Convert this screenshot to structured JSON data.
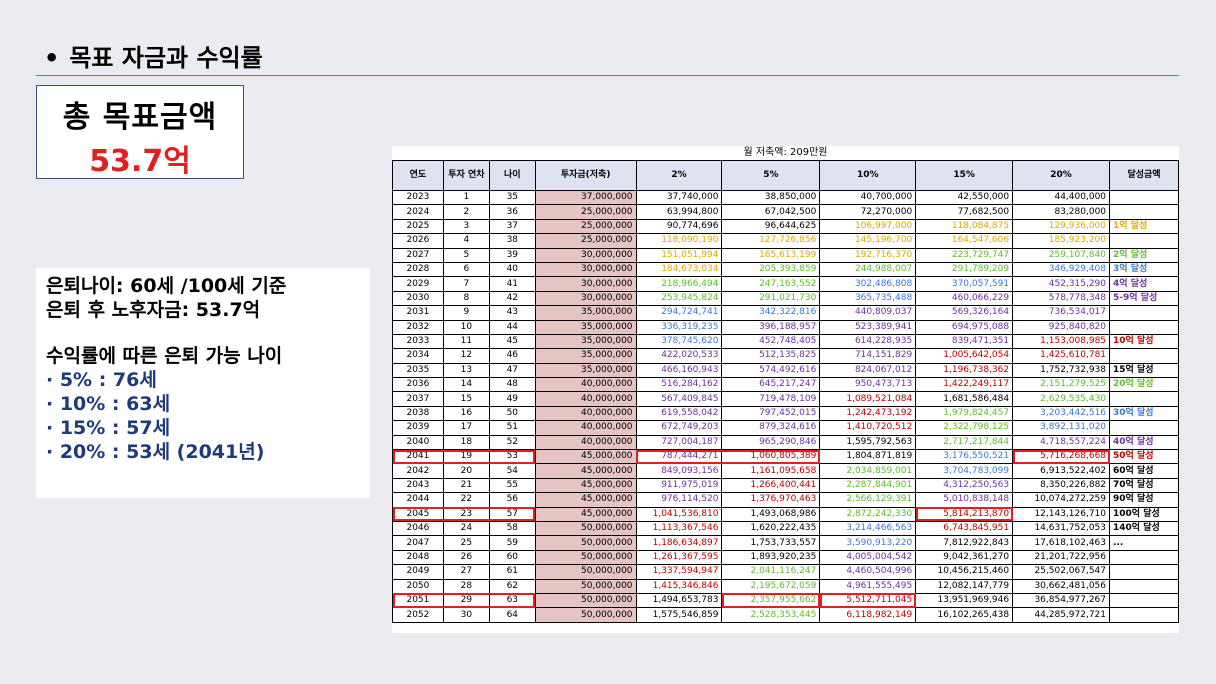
{
  "slide": {
    "bullet": "•",
    "title": "목표 자금과 수익률",
    "goal_label": "총 목표금액",
    "goal_value": "53.7억",
    "info": {
      "retire_age": "은퇴나이: 60세 /100세 기준",
      "retire_fund": "은퇴 후 노후자금: 53.7억",
      "rate_heading": "수익률에 따른 은퇴 가능 나이",
      "rates": [
        "· 5% : 76세",
        "· 10% : 63세",
        "· 15% : 57세",
        "· 20% : 53세 (2041년)"
      ]
    }
  },
  "sheet": {
    "caption": "월 저축액: 209만원",
    "headers": [
      "연도",
      "투자 연차",
      "나이",
      "투자금(저축)",
      "2%",
      "5%",
      "10%",
      "15%",
      "20%",
      "달성금액"
    ],
    "colors": {
      "gray": "#000000",
      "yellow": "#e0a800",
      "green": "#5cbf2a",
      "blue": "#3a78d8",
      "purple": "#7030a0",
      "red": "#c00000",
      "orange": "#e65c00"
    },
    "rows": [
      {
        "y": "2023",
        "n": "1",
        "a": "35",
        "inv": "37,000,000",
        "v": [
          "37,740,000",
          "38,850,000",
          "40,700,000",
          "42,550,000",
          "44,400,000"
        ],
        "c": [
          "k",
          "k",
          "k",
          "k",
          "k"
        ],
        "ach": "",
        "ac": "k"
      },
      {
        "y": "2024",
        "n": "2",
        "a": "36",
        "inv": "25,000,000",
        "v": [
          "63,994,800",
          "67,042,500",
          "72,270,000",
          "77,682,500",
          "83,280,000"
        ],
        "c": [
          "k",
          "k",
          "k",
          "k",
          "k"
        ],
        "ach": "",
        "ac": "k"
      },
      {
        "y": "2025",
        "n": "3",
        "a": "37",
        "inv": "25,000,000",
        "v": [
          "90,774,696",
          "96,644,625",
          "106,997,000",
          "118,084,875",
          "129,936,000"
        ],
        "c": [
          "k",
          "k",
          "y",
          "y",
          "y"
        ],
        "ach": "1억 달성",
        "ac": "y"
      },
      {
        "y": "2026",
        "n": "4",
        "a": "38",
        "inv": "25,000,000",
        "v": [
          "118,090,190",
          "127,726,856",
          "145,196,700",
          "164,547,606",
          "185,923,200"
        ],
        "c": [
          "y",
          "y",
          "y",
          "y",
          "y"
        ],
        "ach": "",
        "ac": "k"
      },
      {
        "y": "2027",
        "n": "5",
        "a": "39",
        "inv": "30,000,000",
        "v": [
          "151,051,994",
          "165,613,199",
          "192,716,370",
          "223,729,747",
          "259,107,840"
        ],
        "c": [
          "y",
          "y",
          "y",
          "g",
          "g"
        ],
        "ach": "2억 달성",
        "ac": "g"
      },
      {
        "y": "2028",
        "n": "6",
        "a": "40",
        "inv": "30,000,000",
        "v": [
          "184,673,034",
          "205,393,859",
          "244,988,007",
          "291,789,209",
          "346,929,408"
        ],
        "c": [
          "y",
          "g",
          "g",
          "g",
          "b"
        ],
        "ach": "3억 달성",
        "ac": "b"
      },
      {
        "y": "2029",
        "n": "7",
        "a": "41",
        "inv": "30,000,000",
        "v": [
          "218,966,494",
          "247,163,552",
          "302,486,808",
          "370,057,591",
          "452,315,290"
        ],
        "c": [
          "g",
          "g",
          "b",
          "b",
          "p"
        ],
        "ach": "4억 달성",
        "ac": "p"
      },
      {
        "y": "2030",
        "n": "8",
        "a": "42",
        "inv": "30,000,000",
        "v": [
          "253,945,824",
          "291,021,730",
          "365,735,488",
          "460,066,229",
          "578,778,348"
        ],
        "c": [
          "g",
          "g",
          "b",
          "p",
          "p"
        ],
        "ach": "5-9억 달성",
        "ac": "p"
      },
      {
        "y": "2031",
        "n": "9",
        "a": "43",
        "inv": "35,000,000",
        "v": [
          "294,724,741",
          "342,322,816",
          "440,809,037",
          "569,326,164",
          "736,534,017"
        ],
        "c": [
          "b",
          "b",
          "p",
          "p",
          "p"
        ],
        "ach": "",
        "ac": "k"
      },
      {
        "y": "2032",
        "n": "10",
        "a": "44",
        "inv": "35,000,000",
        "v": [
          "336,319,235",
          "396,188,957",
          "523,389,941",
          "694,975,088",
          "925,840,820"
        ],
        "c": [
          "b",
          "p",
          "p",
          "p",
          "p"
        ],
        "ach": "",
        "ac": "k"
      },
      {
        "y": "2033",
        "n": "11",
        "a": "45",
        "inv": "35,000,000",
        "v": [
          "378,745,620",
          "452,748,405",
          "614,228,935",
          "839,471,351",
          "1,153,008,985"
        ],
        "c": [
          "b",
          "p",
          "p",
          "p",
          "r"
        ],
        "ach": "10억 달성",
        "ac": "r"
      },
      {
        "y": "2034",
        "n": "12",
        "a": "46",
        "inv": "35,000,000",
        "v": [
          "422,020,533",
          "512,135,825",
          "714,151,829",
          "1,005,642,054",
          "1,425,610,781"
        ],
        "c": [
          "p",
          "p",
          "p",
          "r",
          "r"
        ],
        "ach": "",
        "ac": "k"
      },
      {
        "y": "2035",
        "n": "13",
        "a": "47",
        "inv": "35,000,000",
        "v": [
          "466,160,943",
          "574,492,616",
          "824,067,012",
          "1,196,738,362",
          "1,752,732,938"
        ],
        "c": [
          "p",
          "p",
          "p",
          "r",
          "k"
        ],
        "ach": "15억 달성",
        "ac": "k"
      },
      {
        "y": "2036",
        "n": "14",
        "a": "48",
        "inv": "40,000,000",
        "v": [
          "516,284,162",
          "645,217,247",
          "950,473,713",
          "1,422,249,117",
          "2,151,279,525"
        ],
        "c": [
          "p",
          "p",
          "p",
          "r",
          "g"
        ],
        "ach": "20억 달성",
        "ac": "g"
      },
      {
        "y": "2037",
        "n": "15",
        "a": "49",
        "inv": "40,000,000",
        "v": [
          "567,409,845",
          "719,478,109",
          "1,089,521,084",
          "1,681,586,484",
          "2,629,535,430"
        ],
        "c": [
          "p",
          "p",
          "r",
          "k",
          "g"
        ],
        "ach": "",
        "ac": "k"
      },
      {
        "y": "2038",
        "n": "16",
        "a": "50",
        "inv": "40,000,000",
        "v": [
          "619,558,042",
          "797,452,015",
          "1,242,473,192",
          "1,979,824,457",
          "3,203,442,516"
        ],
        "c": [
          "p",
          "p",
          "r",
          "g",
          "b"
        ],
        "ach": "30억 달성",
        "ac": "b"
      },
      {
        "y": "2039",
        "n": "17",
        "a": "51",
        "inv": "40,000,000",
        "v": [
          "672,749,203",
          "879,324,616",
          "1,410,720,512",
          "2,322,798,125",
          "3,892,131,020"
        ],
        "c": [
          "p",
          "p",
          "r",
          "g",
          "b"
        ],
        "ach": "",
        "ac": "k"
      },
      {
        "y": "2040",
        "n": "18",
        "a": "52",
        "inv": "40,000,000",
        "v": [
          "727,004,187",
          "965,290,846",
          "1,595,792,563",
          "2,717,217,844",
          "4,718,557,224"
        ],
        "c": [
          "p",
          "p",
          "k",
          "g",
          "p"
        ],
        "ach": "40억 달성",
        "ac": "p"
      },
      {
        "y": "2041",
        "n": "19",
        "a": "53",
        "inv": "45,000,000",
        "v": [
          "787,444,271",
          "1,060,805,389",
          "1,804,871,819",
          "3,176,550,521",
          "5,716,268,668"
        ],
        "c": [
          "p",
          "r",
          "k",
          "b",
          "r"
        ],
        "ach": "50억 달성",
        "ac": "r"
      },
      {
        "y": "2042",
        "n": "20",
        "a": "54",
        "inv": "45,000,000",
        "v": [
          "849,093,156",
          "1,161,095,658",
          "2,034,859,001",
          "3,704,783,099",
          "6,913,522,402"
        ],
        "c": [
          "p",
          "r",
          "g",
          "b",
          "k"
        ],
        "ach": "60억 달성",
        "ac": "k"
      },
      {
        "y": "2043",
        "n": "21",
        "a": "55",
        "inv": "45,000,000",
        "v": [
          "911,975,019",
          "1,266,400,441",
          "2,287,844,901",
          "4,312,250,563",
          "8,350,226,882"
        ],
        "c": [
          "p",
          "r",
          "g",
          "p",
          "k"
        ],
        "ach": "70억 달성",
        "ac": "k"
      },
      {
        "y": "2044",
        "n": "22",
        "a": "56",
        "inv": "45,000,000",
        "v": [
          "976,114,520",
          "1,376,970,463",
          "2,566,129,391",
          "5,010,838,148",
          "10,074,272,259"
        ],
        "c": [
          "p",
          "r",
          "g",
          "p",
          "k"
        ],
        "ach": "90억 달성",
        "ac": "k"
      },
      {
        "y": "2045",
        "n": "23",
        "a": "57",
        "inv": "45,000,000",
        "v": [
          "1,041,536,810",
          "1,493,068,986",
          "2,872,242,330",
          "5,814,213,870",
          "12,143,126,710"
        ],
        "c": [
          "r",
          "k",
          "g",
          "r",
          "k"
        ],
        "ach": "100억 달성",
        "ac": "k"
      },
      {
        "y": "2046",
        "n": "24",
        "a": "58",
        "inv": "50,000,000",
        "v": [
          "1,113,367,546",
          "1,620,222,435",
          "3,214,466,563",
          "6,743,845,951",
          "14,631,752,053"
        ],
        "c": [
          "r",
          "k",
          "b",
          "r",
          "k"
        ],
        "ach": "140억 달성",
        "ac": "k"
      },
      {
        "y": "2047",
        "n": "25",
        "a": "59",
        "inv": "50,000,000",
        "v": [
          "1,186,634,897",
          "1,753,733,557",
          "3,590,913,220",
          "7,812,922,843",
          "17,618,102,463"
        ],
        "c": [
          "r",
          "k",
          "b",
          "k",
          "k"
        ],
        "ach": "...",
        "ac": "k"
      },
      {
        "y": "2048",
        "n": "26",
        "a": "60",
        "inv": "50,000,000",
        "v": [
          "1,261,367,595",
          "1,893,920,235",
          "4,005,004,542",
          "9,042,361,270",
          "21,201,722,956"
        ],
        "c": [
          "r",
          "k",
          "p",
          "k",
          "k"
        ],
        "ach": "",
        "ac": "k"
      },
      {
        "y": "2049",
        "n": "27",
        "a": "61",
        "inv": "50,000,000",
        "v": [
          "1,337,594,947",
          "2,041,116,247",
          "4,460,504,996",
          "10,456,215,460",
          "25,502,067,547"
        ],
        "c": [
          "r",
          "g",
          "p",
          "k",
          "k"
        ],
        "ach": "",
        "ac": "k"
      },
      {
        "y": "2050",
        "n": "28",
        "a": "62",
        "inv": "50,000,000",
        "v": [
          "1,415,346,846",
          "2,195,672,059",
          "4,961,555,495",
          "12,082,147,779",
          "30,662,481,056"
        ],
        "c": [
          "r",
          "g",
          "p",
          "k",
          "k"
        ],
        "ach": "",
        "ac": "k"
      },
      {
        "y": "2051",
        "n": "29",
        "a": "63",
        "inv": "50,000,000",
        "v": [
          "1,494,653,783",
          "2,357,955,662",
          "5,512,711,045",
          "13,951,969,946",
          "36,854,977,267"
        ],
        "c": [
          "k",
          "g",
          "r",
          "k",
          "k"
        ],
        "ach": "",
        "ac": "k"
      },
      {
        "y": "2052",
        "n": "30",
        "a": "64",
        "inv": "50,000,000",
        "v": [
          "1,575,546,859",
          "2,528,353,445",
          "6,118,982,149",
          "16,102,265,438",
          "44,285,972,721"
        ],
        "c": [
          "k",
          "g",
          "r",
          "k",
          "k"
        ],
        "ach": "",
        "ac": "k"
      }
    ]
  }
}
